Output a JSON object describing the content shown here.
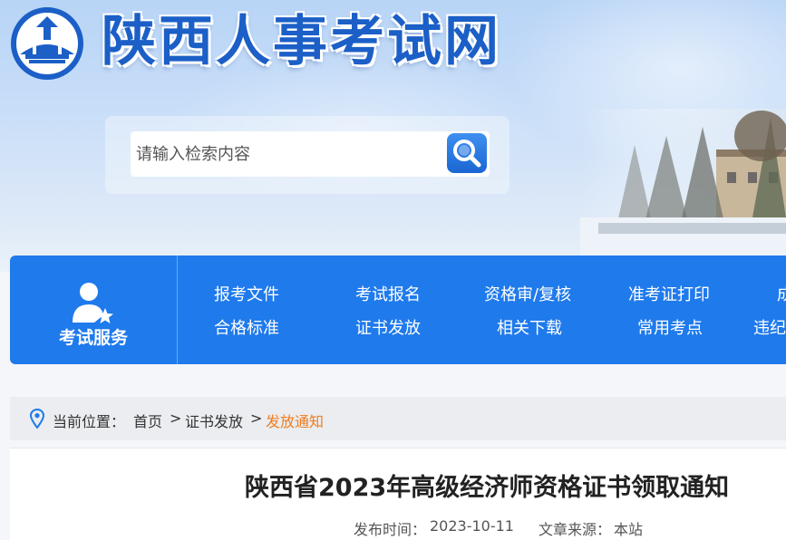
{
  "header": {
    "site_title": "陕西人事考试网",
    "search_placeholder": "请输入检索内容"
  },
  "service": {
    "label": "考试服务",
    "row1": [
      "报考文件",
      "考试报名",
      "资格审/复核",
      "准考证打印",
      "成"
    ],
    "row2": [
      "合格标准",
      "证书发放",
      "相关下载",
      "常用考点",
      "违纪"
    ]
  },
  "breadcrumb": {
    "prefix": "当前位置：",
    "items": [
      "首页",
      "证书发放",
      "发放通知"
    ],
    "separator": ">"
  },
  "article": {
    "title": "陕西省2023年高级经济师资格证书领取通知",
    "date_label": "发布时间：",
    "date": "2023-10-11",
    "source_label": "文章来源：",
    "source": "本站"
  },
  "colors": {
    "brand_blue": "#1f7aec",
    "title_blue": "#1b5fc7",
    "active_crumb": "#f07c1e"
  }
}
